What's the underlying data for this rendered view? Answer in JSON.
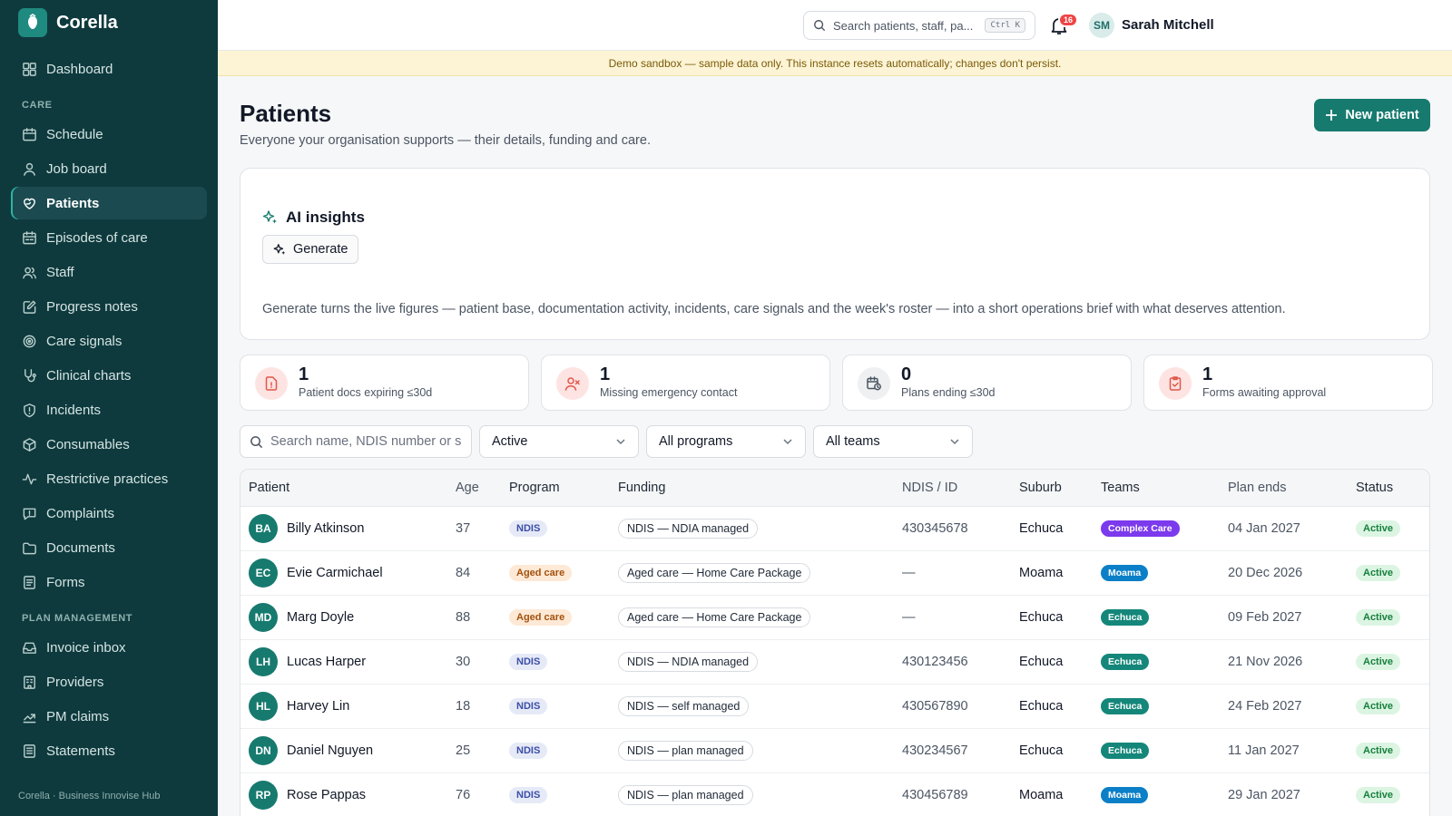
{
  "app": {
    "name": "Corella",
    "footer": "Corella · Business Innovise Hub"
  },
  "sidebar": {
    "top": [
      {
        "label": "Dashboard",
        "icon": "dashboard-icon"
      }
    ],
    "sections": [
      {
        "title": "CARE",
        "items": [
          {
            "label": "Schedule",
            "icon": "calendar-icon"
          },
          {
            "label": "Job board",
            "icon": "user-icon"
          },
          {
            "label": "Patients",
            "icon": "heart-hand-icon",
            "active": true
          },
          {
            "label": "Episodes of care",
            "icon": "calendar-range-icon"
          },
          {
            "label": "Staff",
            "icon": "users-icon"
          },
          {
            "label": "Progress notes",
            "icon": "edit-note-icon"
          },
          {
            "label": "Care signals",
            "icon": "signal-icon"
          },
          {
            "label": "Clinical charts",
            "icon": "stethoscope-icon"
          },
          {
            "label": "Incidents",
            "icon": "shield-alert-icon"
          },
          {
            "label": "Consumables",
            "icon": "package-icon"
          },
          {
            "label": "Restrictive practices",
            "icon": "activity-icon"
          },
          {
            "label": "Complaints",
            "icon": "message-alert-icon"
          },
          {
            "label": "Documents",
            "icon": "folder-icon"
          },
          {
            "label": "Forms",
            "icon": "form-icon"
          }
        ]
      },
      {
        "title": "PLAN MANAGEMENT",
        "items": [
          {
            "label": "Invoice inbox",
            "icon": "inbox-icon"
          },
          {
            "label": "Providers",
            "icon": "building-icon"
          },
          {
            "label": "PM claims",
            "icon": "claims-icon"
          },
          {
            "label": "Statements",
            "icon": "statement-icon"
          }
        ]
      }
    ]
  },
  "topbar": {
    "search_placeholder": "Search patients, staff, pa...",
    "shortcut": "Ctrl K",
    "notification_count": "16",
    "user_initials": "SM",
    "user_name": "Sarah Mitchell"
  },
  "banner": "Demo sandbox — sample data only. This instance resets automatically; changes don't persist.",
  "page": {
    "title": "Patients",
    "subtitle": "Everyone your organisation supports — their details, funding and care.",
    "new_button": "New patient"
  },
  "ai": {
    "title": "AI insights",
    "button": "Generate",
    "description": "Generate turns the live figures — patient base, documentation activity, incidents, care signals and the week's roster — into a short operations brief with what deserves attention."
  },
  "stats": [
    {
      "value": "1",
      "label": "Patient docs expiring ≤30d",
      "icon": "file-alert-icon",
      "color": "#fde3e1",
      "icon_color": "#e0574b"
    },
    {
      "value": "1",
      "label": "Missing emergency contact",
      "icon": "user-x-icon",
      "color": "#fde3e1",
      "icon_color": "#e0574b"
    },
    {
      "value": "0",
      "label": "Plans ending ≤30d",
      "icon": "calendar-clock-icon",
      "color": "#eef0f2",
      "icon_color": "#4b5563"
    },
    {
      "value": "1",
      "label": "Forms awaiting approval",
      "icon": "clipboard-check-icon",
      "color": "#fde3e1",
      "icon_color": "#e0574b"
    }
  ],
  "filters": {
    "search_placeholder": "Search name, NDIS number or s",
    "status": "Active",
    "program": "All programs",
    "team": "All teams"
  },
  "table": {
    "columns": [
      "Patient",
      "Age",
      "Program",
      "Funding",
      "NDIS / ID",
      "Suburb",
      "Teams",
      "Plan ends",
      "Status"
    ],
    "rows": [
      {
        "initials": "BA",
        "name": "Billy Atkinson",
        "age": "37",
        "program": "NDIS",
        "funding": "NDIS — NDIA managed",
        "ndis": "430345678",
        "suburb": "Echuca",
        "team": "Complex Care",
        "team_color": "#7c3aed",
        "plan_ends": "04 Jan 2027",
        "status": "Active"
      },
      {
        "initials": "EC",
        "name": "Evie Carmichael",
        "age": "84",
        "program": "Aged care",
        "funding": "Aged care — Home Care Package",
        "ndis": "—",
        "suburb": "Moama",
        "team": "Moama",
        "team_color": "#0b7fc7",
        "plan_ends": "20 Dec 2026",
        "status": "Active"
      },
      {
        "initials": "MD",
        "name": "Marg Doyle",
        "age": "88",
        "program": "Aged care",
        "funding": "Aged care — Home Care Package",
        "ndis": "—",
        "suburb": "Echuca",
        "team": "Echuca",
        "team_color": "#15877a",
        "plan_ends": "09 Feb 2027",
        "status": "Active"
      },
      {
        "initials": "LH",
        "name": "Lucas Harper",
        "age": "30",
        "program": "NDIS",
        "funding": "NDIS — NDIA managed",
        "ndis": "430123456",
        "suburb": "Echuca",
        "team": "Echuca",
        "team_color": "#15877a",
        "plan_ends": "21 Nov 2026",
        "status": "Active"
      },
      {
        "initials": "HL",
        "name": "Harvey Lin",
        "age": "18",
        "program": "NDIS",
        "funding": "NDIS — self managed",
        "ndis": "430567890",
        "suburb": "Echuca",
        "team": "Echuca",
        "team_color": "#15877a",
        "plan_ends": "24 Feb 2027",
        "status": "Active"
      },
      {
        "initials": "DN",
        "name": "Daniel Nguyen",
        "age": "25",
        "program": "NDIS",
        "funding": "NDIS — plan managed",
        "ndis": "430234567",
        "suburb": "Echuca",
        "team": "Echuca",
        "team_color": "#15877a",
        "plan_ends": "11 Jan 2027",
        "status": "Active"
      },
      {
        "initials": "RP",
        "name": "Rose Pappas",
        "age": "76",
        "program": "NDIS",
        "funding": "NDIS — plan managed",
        "ndis": "430456789",
        "suburb": "Moama",
        "team": "Moama",
        "team_color": "#0b7fc7",
        "plan_ends": "29 Jan 2027",
        "status": "Active"
      }
    ]
  },
  "colors": {
    "sidebar": "#0e3a3e",
    "accent": "#177a6f",
    "banner": "#fdf4d6",
    "active_status": "#17803d"
  }
}
